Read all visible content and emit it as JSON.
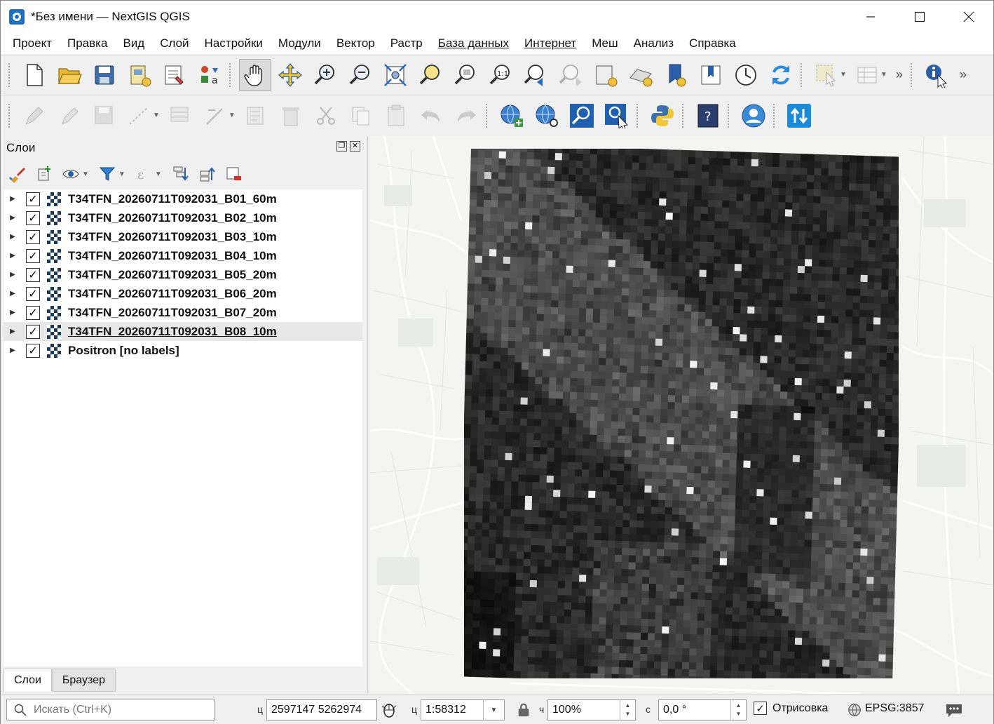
{
  "window": {
    "title": "*Без имени — NextGIS QGIS",
    "controls": [
      "minimize-icon",
      "maximize-icon",
      "close-icon"
    ]
  },
  "menu": [
    "Проект",
    "Правка",
    "Вид",
    "Слой",
    "Настройки",
    "Модули",
    "Вектор",
    "Растр",
    "База данных",
    "Интернет",
    "Меш",
    "Анализ",
    "Справка"
  ],
  "layers_panel": {
    "title": "Слои",
    "layers": [
      {
        "name": "T34TFN_20260711T092031_B01_60m",
        "checked": true,
        "selected": false
      },
      {
        "name": "T34TFN_20260711T092031_B02_10m",
        "checked": true,
        "selected": false
      },
      {
        "name": "T34TFN_20260711T092031_B03_10m",
        "checked": true,
        "selected": false
      },
      {
        "name": "T34TFN_20260711T092031_B04_10m",
        "checked": true,
        "selected": false
      },
      {
        "name": "T34TFN_20260711T092031_B05_20m",
        "checked": true,
        "selected": false
      },
      {
        "name": "T34TFN_20260711T092031_B06_20m",
        "checked": true,
        "selected": false
      },
      {
        "name": "T34TFN_20260711T092031_B07_20m",
        "checked": true,
        "selected": false
      },
      {
        "name": "T34TFN_20260711T092031_B08_10m",
        "checked": true,
        "selected": true
      },
      {
        "name": "Positron [no labels]",
        "checked": true,
        "selected": false
      }
    ],
    "tabs": [
      "Слои",
      "Браузер"
    ],
    "active_tab": "Слои"
  },
  "status": {
    "search_placeholder": "Искать (Ctrl+K)",
    "coord_label": "ц",
    "coordinates": "2597147  5262974",
    "scale_label": "ц",
    "scale": "1:58312",
    "magnifier_label": "ч",
    "magnifier": "100%",
    "rotation_label": "с",
    "rotation": "0,0 °",
    "render_label": "Отрисовка",
    "render_checked": true,
    "crs": "EPSG:3857"
  },
  "colors": {
    "accent": "#1f6fbf",
    "selected_row": "#e8e8e8",
    "map_background": "#f4f4f2"
  },
  "check_mark": "✓"
}
